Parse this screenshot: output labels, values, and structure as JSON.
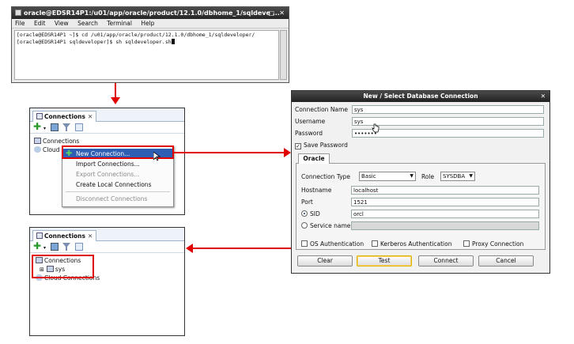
{
  "terminal": {
    "title": "oracle@EDSR14P1:/u01/app/oracle/product/12.1.0/dbhome_1/sqldeve ...",
    "window_buttons": [
      "□",
      "✕"
    ],
    "menu": [
      "File",
      "Edit",
      "View",
      "Search",
      "Terminal",
      "Help"
    ],
    "line1": "[oracle@EDSR14P1 ~]$ cd /u01/app/oracle/product/12.1.0/dbhome_1/sqldeveloper/",
    "line2": "[oracle@EDSR14P1 sqldeveloper]$ sh sqldeveloper.sh"
  },
  "panel_top": {
    "tab_label": "Connections",
    "tree": [
      "Connections",
      "Cloud"
    ],
    "context_menu": {
      "highlighted": "New Connection...",
      "items": [
        "Import Connections...",
        "Export Connections...",
        "Create Local Connections"
      ],
      "disconnect": "Disconnect Connections"
    }
  },
  "panel_bottom": {
    "tab_label": "Connections",
    "tree_root": "Connections",
    "tree_child": "sys",
    "tree_cloud": "Cloud Connections"
  },
  "dialog": {
    "title": "New / Select Database Connection",
    "close": "✕",
    "connection_name_label": "Connection Name",
    "connection_name": "sys",
    "username_label": "Username",
    "username": "sys",
    "password_label": "Password",
    "password": "•••••••",
    "save_password_label": "Save Password",
    "tab": "Oracle",
    "connection_type_label": "Connection Type",
    "connection_type": "Basic",
    "role_label": "Role",
    "role": "SYSDBA",
    "hostname_label": "Hostname",
    "hostname": "localhost",
    "port_label": "Port",
    "port": "1521",
    "sid_label": "SID",
    "sid": "orcl",
    "service_name_label": "Service name",
    "os_auth": "OS Authentication",
    "kerberos_auth": "Kerberos Authentication",
    "proxy_conn": "Proxy Connection",
    "buttons": {
      "clear": "Clear",
      "test": "Test",
      "connect": "Connect",
      "cancel": "Cancel"
    }
  },
  "colors": {
    "highlight": "#e00000",
    "menu_selection": "#2f5fb5",
    "title_bar": "#2b2b2b"
  }
}
